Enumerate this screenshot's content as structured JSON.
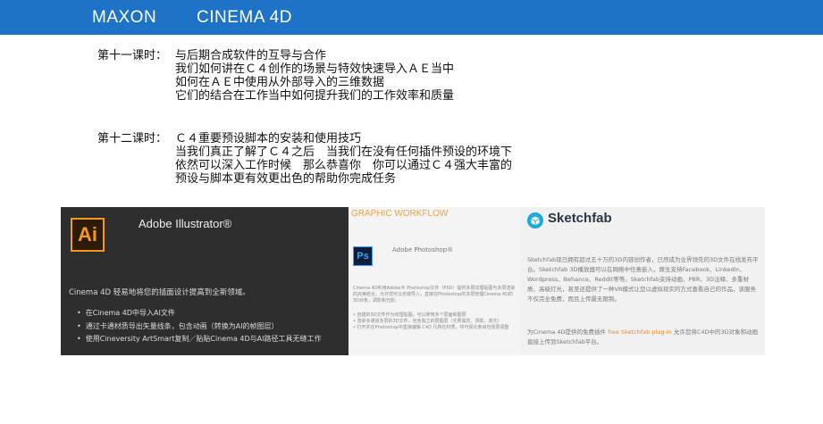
{
  "header": {
    "brand": "MAXON",
    "product": "CINEMA 4D",
    "bg_color": "#1e73c8"
  },
  "lessons": [
    {
      "label": "第十一课时：",
      "lines": [
        "与后期合成软件的互导与合作",
        "我们如何讲在Ｃ４创作的场景与特效快速导入ＡＥ当中",
        "如何在ＡＥ中使用从外部导入的三维数据",
        "它们的结合在工作当中如何提升我们的工作效率和质量"
      ]
    },
    {
      "label": "第十二课时：",
      "lines": [
        "Ｃ４重要预设脚本的安装和使用技巧",
        "当我们真正了解了Ｃ４之后　当我们在没有任何插件预设的环境下",
        "依然可以深入工作时候　那么恭喜你　你可以通过Ｃ４强大丰富的",
        "预设与脚本更有效更出色的帮助你完成任务"
      ]
    }
  ],
  "panels": {
    "illustrator": {
      "logo": "Ai",
      "title": "Adobe Illustrator®",
      "description": "Cinema 4D 轻易地将您的插面设计提高到全新领域。",
      "items": [
        "在Cinema 4D中导入AI文件",
        "通过卡通材质导出矢量线条，包含动画（转换为AI的帧图层）",
        "使用Cineversity ArtSmart复制／贴贴Cinema 4D与AI路径工具无缝工作"
      ],
      "accent_color": "#f29a1d"
    },
    "photoshop": {
      "heading": "GRAPHIC WORKFLOW",
      "logo": "Ps",
      "title": "Adobe Photoshop®",
      "description": "Cinema 4D利用Adobe® Photoshop文件（PSD）提供多层纹理贴图与多层渲染的完美结合。允许您可以无缝导入，直接在Photoshop的多层管理Cinema 4D的3D对象，调影和光影。",
      "items": [
        "自建的3D文件作为纹理贴图，可以使用多个层面和图层",
        "渲染多通道多层的3D文件，包含独立的层图层（光照属性、阴影、高光）",
        "打开并在Photoshop中直接编辑 C4D 凡所在材质，将可视化条目包括层调整"
      ],
      "accent_color": "#f0a23a"
    },
    "sketchfab": {
      "name": "Sketchfab",
      "description": "Sketchfab现已拥有超过五十万的3D内容创作者，已然成为业界领先的3D文件在线发布平台。Sketchfab 3D播放器可以在网络中任意嵌入，原生支持Facebook、LinkedIn、Wordpress、Behance、Reddit等等。Sketchfab支持动画、PBR、3D注释、多重材质、高级灯光，甚至还提供了一种VR模式让您以虚拟现实的方式查看自己的作品，该服务不仅完全免费，而且上传最无限制。",
      "footer_before": "为Cinema 4D提供的免费插件",
      "footer_link": "free Sketchfab plug-in",
      "footer_after": "允许您将C4D中的3D对象和动画直接上传到Sketchfab平台。",
      "link_color": "#e38a2d"
    }
  }
}
